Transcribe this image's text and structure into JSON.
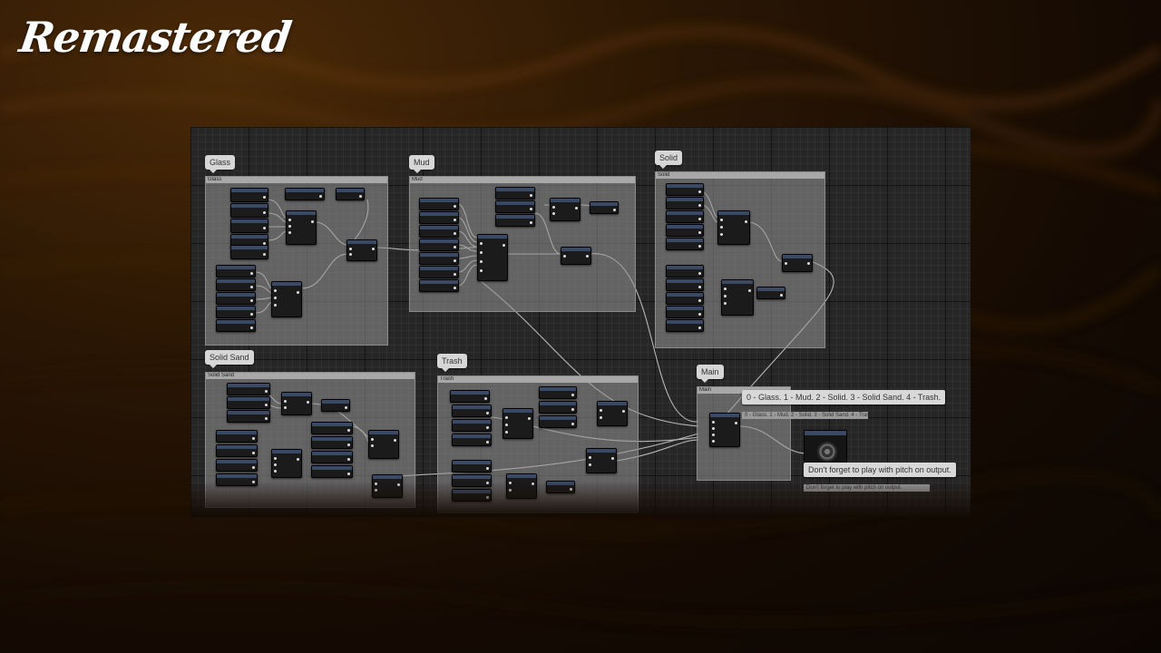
{
  "title": "Remastered",
  "groups": [
    {
      "label": "Glass"
    },
    {
      "label": "Mud"
    },
    {
      "label": "Solid"
    },
    {
      "label": "Solid Sand"
    },
    {
      "label": "Trash"
    },
    {
      "label": "Main"
    }
  ],
  "tooltips": {
    "index_info": "0 - Glass. 1 - Mud. 2 - Solid. 3 - Solid Sand. 4 - Trash.",
    "pitch_info": "Don't forget to play with pitch on output."
  },
  "colors": {
    "accent_text": "#ffffff",
    "grid_bg": "#262626",
    "group_bar": "#a8a8a8"
  }
}
